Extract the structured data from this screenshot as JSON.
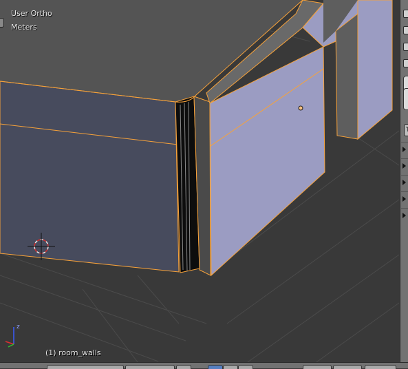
{
  "viewport": {
    "view_name": "User Ortho",
    "units": "Meters",
    "object_info": "(1) room_walls"
  },
  "axis": {
    "z_label": "z"
  },
  "tool_shelf": {
    "tab_label": "T"
  },
  "colors": {
    "background": "#393939",
    "grid": "#4b4b4b",
    "wall_face_dark": "#474b5d",
    "wall_face_selected": "#9b9cc2",
    "wall_top": "#545454",
    "selection_outline": "#f7a23a",
    "panel_bg": "#727272",
    "active_button": "#5680c2"
  },
  "icons": [
    "3d-cursor-icon",
    "axis-gizmo-icon",
    "origin-dot-icon",
    "panel-arrow-icon"
  ]
}
